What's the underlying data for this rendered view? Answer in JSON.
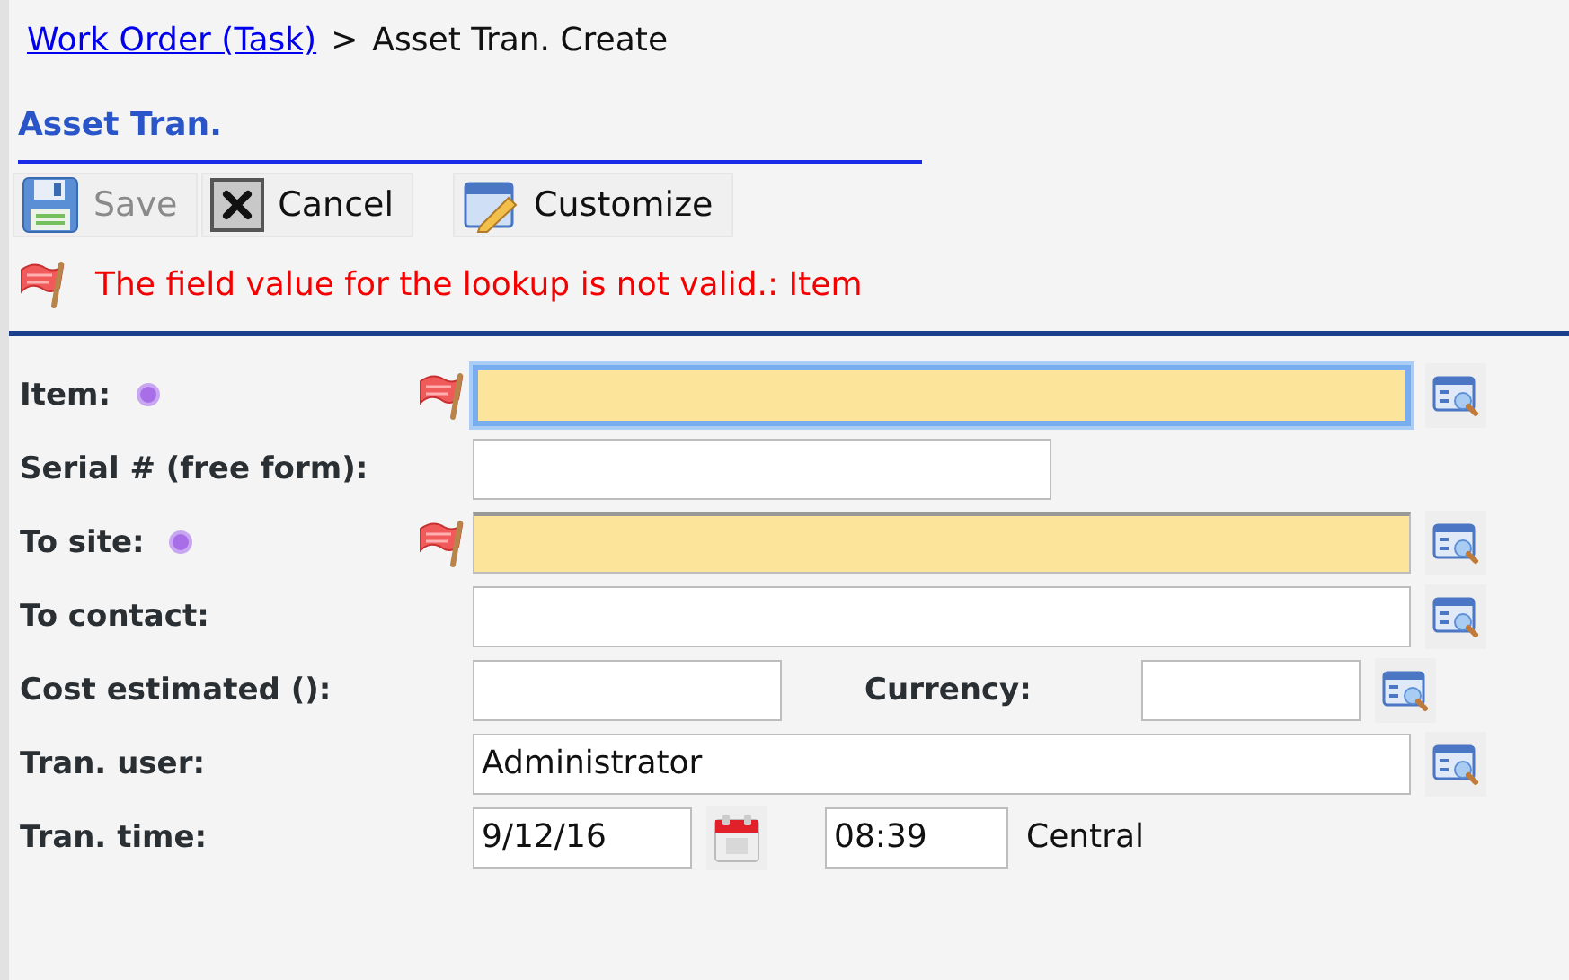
{
  "breadcrumb": {
    "link": "Work Order (Task)",
    "separator": ">",
    "current": "Asset Tran. Create"
  },
  "section_title": "Asset Tran.",
  "toolbar": [
    {
      "kind": "save",
      "label": "Save",
      "disabled": true
    },
    {
      "kind": "cancel",
      "label": "Cancel",
      "disabled": false
    },
    {
      "kind": "customize",
      "label": "Customize",
      "disabled": false
    }
  ],
  "error_message": "The field value for the lookup is not valid.: Item",
  "form": {
    "rows": [
      {
        "kind": "lookup",
        "label": "Item:",
        "required": true,
        "invalid": true,
        "focused": true
      },
      {
        "kind": "text",
        "label": "Serial # (free form):",
        "required": false,
        "invalid": false,
        "focused": false
      },
      {
        "kind": "lookup",
        "label": "To site:",
        "required": true,
        "invalid": true,
        "focused": false
      },
      {
        "kind": "lookup",
        "label": "To contact:",
        "required": false,
        "invalid": false,
        "focused": false
      },
      {
        "kind": "pair",
        "label": "Cost estimated ():",
        "second_label": "Currency:",
        "required": false,
        "invalid": false,
        "focused": false
      },
      {
        "kind": "lookup",
        "label": "Tran. user:",
        "value": "Administrator",
        "required": false,
        "invalid": false,
        "focused": false
      },
      {
        "kind": "datetime",
        "label": "Tran. time:",
        "date": "9/12/16",
        "time": "08:39",
        "timezone": "Central",
        "required": false,
        "invalid": false,
        "focused": false
      }
    ]
  }
}
